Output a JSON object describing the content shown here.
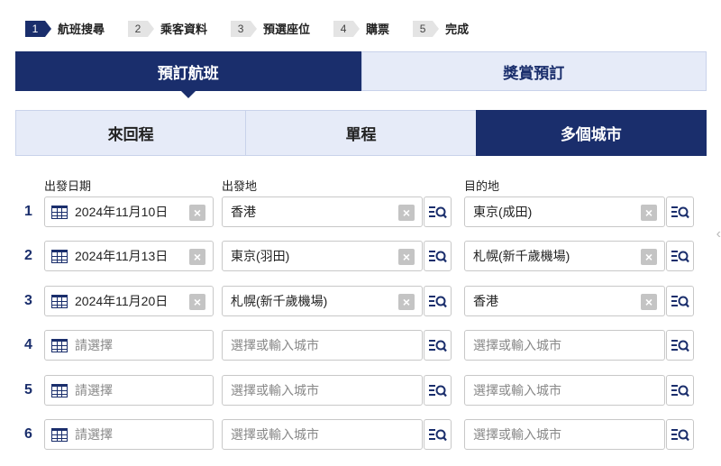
{
  "steps": [
    {
      "num": "1",
      "label": "航班搜尋",
      "active": true
    },
    {
      "num": "2",
      "label": "乘客資料",
      "active": false
    },
    {
      "num": "3",
      "label": "預選座位",
      "active": false
    },
    {
      "num": "4",
      "label": "購票",
      "active": false
    },
    {
      "num": "5",
      "label": "完成",
      "active": false
    }
  ],
  "main_tabs": [
    {
      "label": "預訂航班",
      "active": true
    },
    {
      "label": "獎賞預訂",
      "active": false
    }
  ],
  "trip_tabs": [
    {
      "label": "來回程",
      "active": false
    },
    {
      "label": "單程",
      "active": false
    },
    {
      "label": "多個城市",
      "active": true
    }
  ],
  "headers": {
    "date": "出發日期",
    "origin": "出發地",
    "destination": "目的地"
  },
  "rows": [
    {
      "num": "1",
      "date": "2024年11月10日",
      "origin": "香港",
      "destination": "東京(成田)"
    },
    {
      "num": "2",
      "date": "2024年11月13日",
      "origin": "東京(羽田)",
      "destination": "札幌(新千歲機場)"
    },
    {
      "num": "3",
      "date": "2024年11月20日",
      "origin": "札幌(新千歲機場)",
      "destination": "香港"
    },
    {
      "num": "4",
      "date": "",
      "origin": "",
      "destination": ""
    },
    {
      "num": "5",
      "date": "",
      "origin": "",
      "destination": ""
    },
    {
      "num": "6",
      "date": "",
      "origin": "",
      "destination": ""
    }
  ],
  "placeholders": {
    "date": "請選擇",
    "city": "選擇或輸入城市"
  },
  "icons": {
    "calendar": "calendar-icon",
    "clear": "clear-icon",
    "city_search": "list-search-icon"
  },
  "colors": {
    "brand": "#1a2e6c",
    "tab_inactive": "#e6ebf8"
  }
}
